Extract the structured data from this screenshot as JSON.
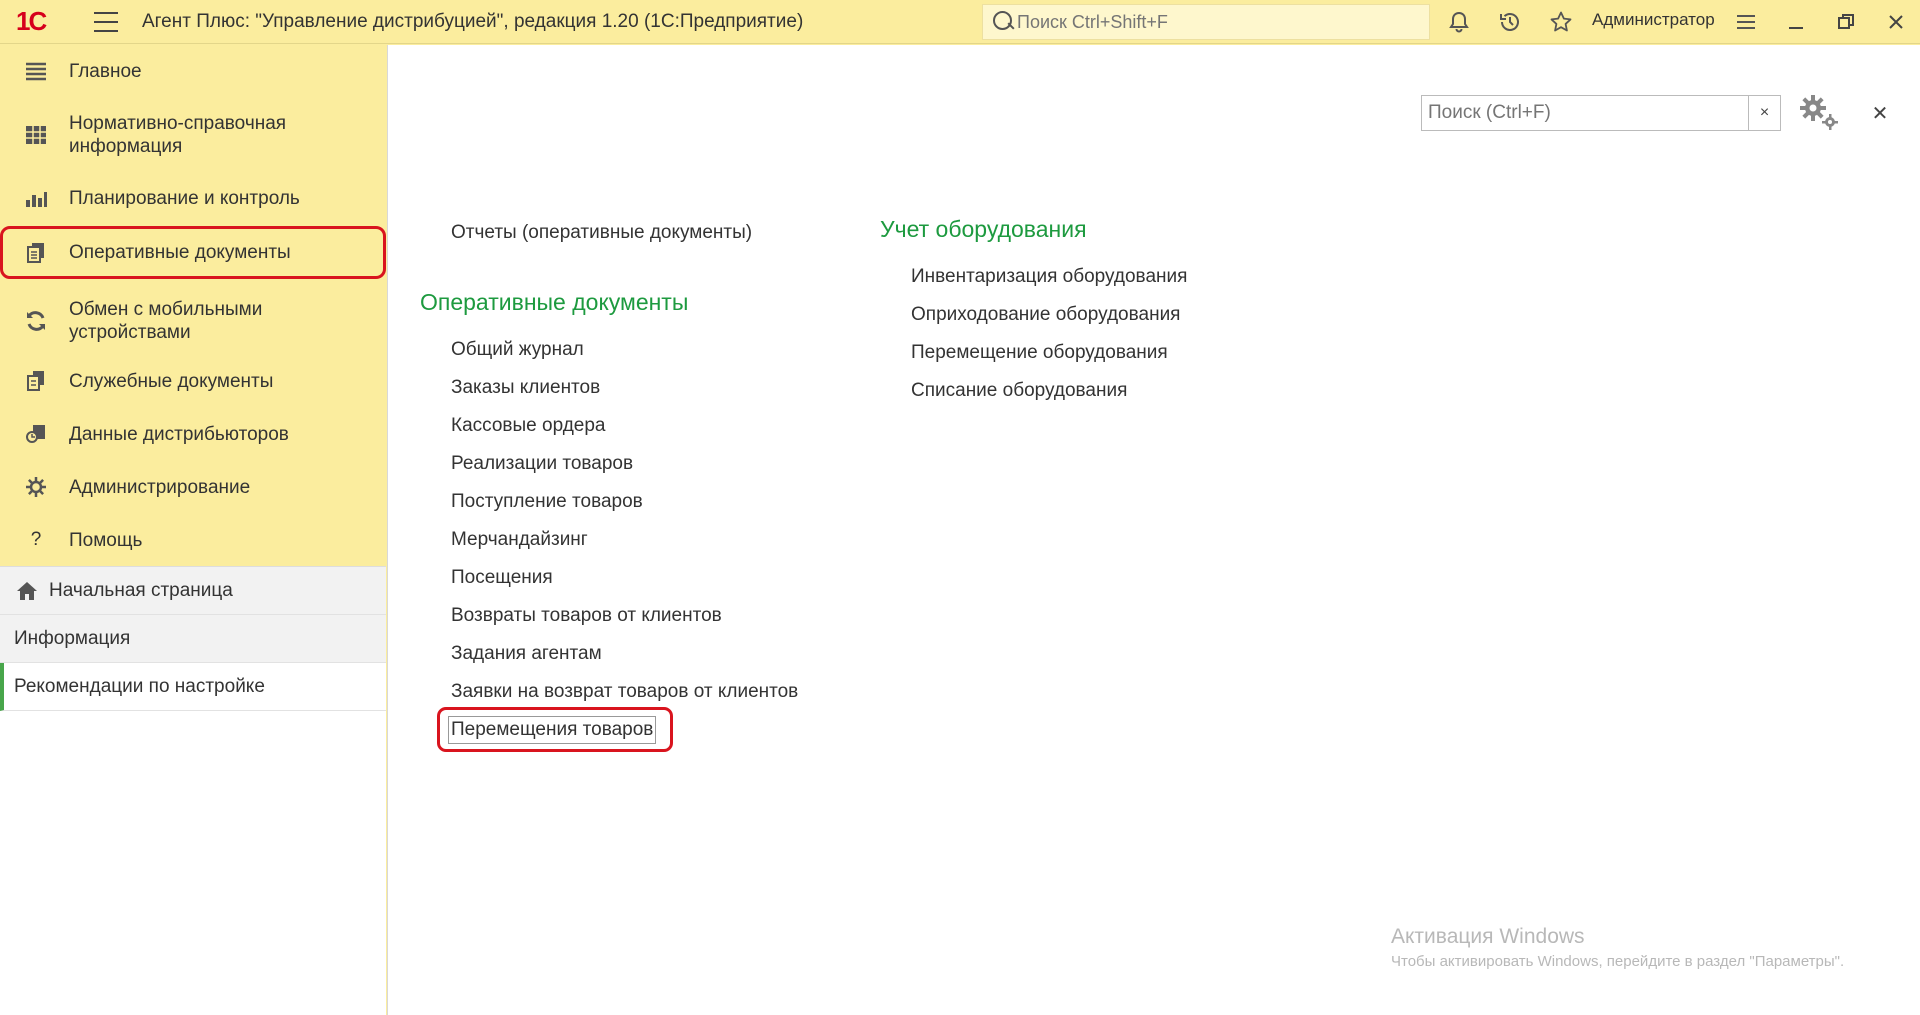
{
  "app": {
    "logo": "1С",
    "title": "Агент Плюс: \"Управление дистрибуцией\", редакция 1.20  (1С:Предприятие)",
    "search_placeholder": "Поиск Ctrl+Shift+F",
    "user": "Администратор"
  },
  "sidebar": {
    "items": [
      {
        "label": "Главное",
        "icon": "menu-lines-icon"
      },
      {
        "label": "Нормативно-справочная\nинформация",
        "icon": "table-icon"
      },
      {
        "label": "Планирование и контроль",
        "icon": "bar-chart-icon"
      },
      {
        "label": "Оперативные документы",
        "icon": "documents-icon",
        "active": true
      },
      {
        "label": "Обмен с мобильными\nустройствами",
        "icon": "sync-icon"
      },
      {
        "label": "Служебные документы",
        "icon": "service-docs-icon"
      },
      {
        "label": "Данные дистрибьюторов",
        "icon": "distributor-data-icon"
      },
      {
        "label": "Администрирование",
        "icon": "gear-icon"
      },
      {
        "label": "Помощь",
        "icon": "question-icon"
      }
    ],
    "bottom": [
      {
        "label": "Начальная страница",
        "icon": "home-icon"
      },
      {
        "label": "Информация"
      },
      {
        "label": "Рекомендации по настройке",
        "selected": true
      }
    ]
  },
  "main": {
    "search_placeholder": "Поиск (Ctrl+F)",
    "reports_link": "Отчеты (оперативные документы)",
    "groups": [
      {
        "title": "Оперативные документы",
        "links": [
          "Общий журнал",
          "Заказы клиентов",
          "Кассовые ордера",
          "Реализации товаров",
          "Поступление товаров",
          "Мерчандайзинг",
          "Посещения",
          "Возвраты товаров от клиентов",
          "Задания агентам",
          "Заявки на возврат товаров от клиентов",
          "Перемещения товаров"
        ]
      },
      {
        "title": "Учет оборудования",
        "links": [
          "Инвентаризация оборудования",
          "Оприходование оборудования",
          "Перемещение оборудования",
          "Списание оборудования"
        ]
      }
    ]
  },
  "watermark": {
    "line1": "Активация Windows",
    "line2": "Чтобы активировать Windows, перейдите в раздел \"Параметры\"."
  },
  "colors": {
    "panel": "#fbed9e",
    "group_title": "#1d9a3f",
    "highlight": "#d9141e"
  }
}
